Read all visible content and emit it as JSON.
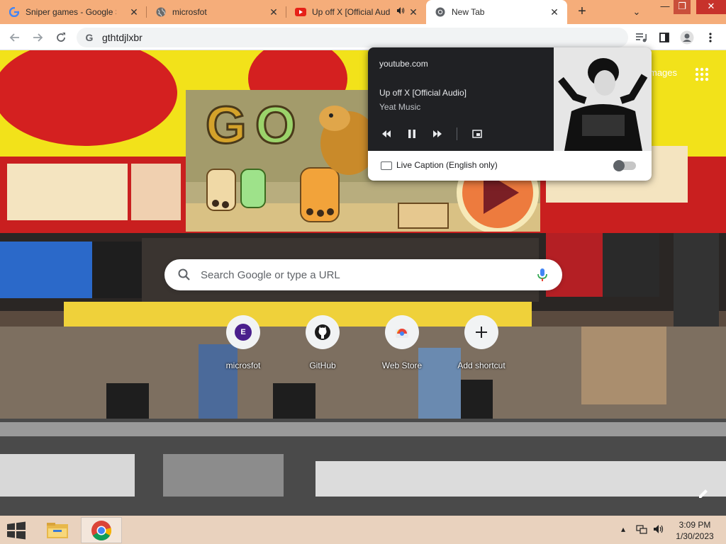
{
  "tabs": [
    {
      "title": "Sniper games - Google Se",
      "favicon": "google-icon",
      "active": false
    },
    {
      "title": "microsfot",
      "favicon": "globe-icon",
      "active": false
    },
    {
      "title": "Up off X [Official Aud",
      "favicon": "youtube-icon",
      "active": false,
      "audio": true
    },
    {
      "title": "New Tab",
      "favicon": "chrome-icon",
      "active": true
    }
  ],
  "toolbar": {
    "url": "gthtdjlxbr"
  },
  "ntp": {
    "images_link": "mages",
    "search_placeholder": "Search Google or type a URL",
    "shortcuts": [
      {
        "label": "microsfot",
        "icon": "letter-e-icon",
        "letter": "E"
      },
      {
        "label": "GitHub",
        "icon": "github-icon"
      },
      {
        "label": "Web Store",
        "icon": "web-store-icon"
      },
      {
        "label": "Add shortcut",
        "icon": "plus-icon"
      }
    ]
  },
  "media": {
    "origin": "youtube.com",
    "title": "Up off X [Official Audio]",
    "artist": "Yeat Music",
    "live_caption_label": "Live Caption (English only)",
    "live_caption_enabled": false
  },
  "taskbar": {
    "time": "3:09 PM",
    "date": "1/30/2023"
  },
  "colors": {
    "tabstrip": "#f5ad7a",
    "close_button": "#c7322b",
    "media_bg": "#202124",
    "taskbar": "#e9d2be"
  }
}
